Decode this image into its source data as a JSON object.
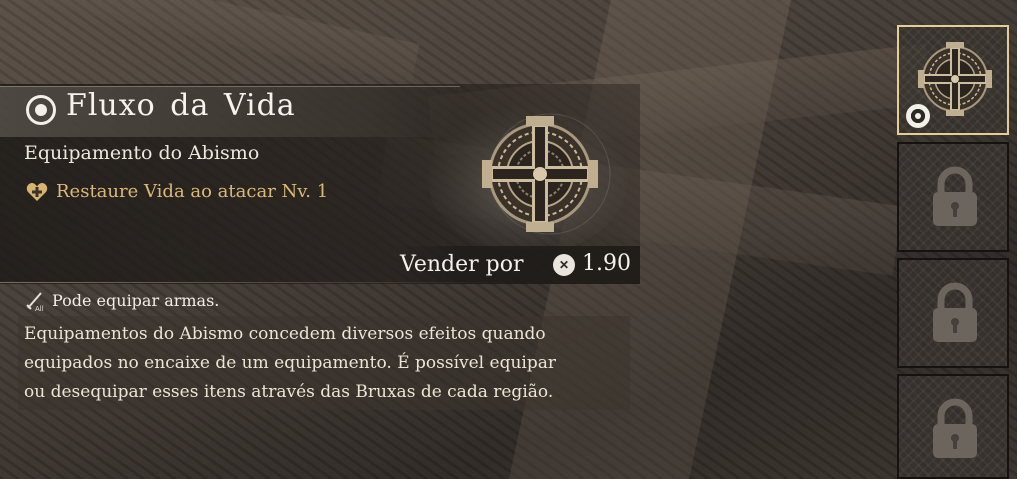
{
  "item": {
    "name": "Fluxo da Vida",
    "type": "Equipamento do Abismo",
    "effect": "Restaure Vida ao atacar Nv. 1",
    "effect_icon": "heart-plus-icon",
    "item_icon": "abyss-gear-icon"
  },
  "sell": {
    "label": "Vender por",
    "currency_icon": "coin-icon",
    "value": "1.90"
  },
  "equip": {
    "icon": "sword-icon",
    "note": "Pode equipar armas."
  },
  "description": {
    "lines": [
      "Equipamentos do Abismo concedem diversos efeitos quando",
      "equipados no encaixe de um equipamento. É possível equipar",
      "ou desequipar esses itens através das Bruxas de cada região."
    ]
  },
  "slots": [
    {
      "state": "equipped",
      "icon": "abyss-gear-icon"
    },
    {
      "state": "locked",
      "icon": "lock-icon"
    },
    {
      "state": "locked",
      "icon": "lock-icon"
    },
    {
      "state": "locked",
      "icon": "lock-icon"
    }
  ],
  "colors": {
    "accent_gold": "#dcb978",
    "selected_border": "#e3cf95",
    "text_light": "#f6f3ee"
  }
}
